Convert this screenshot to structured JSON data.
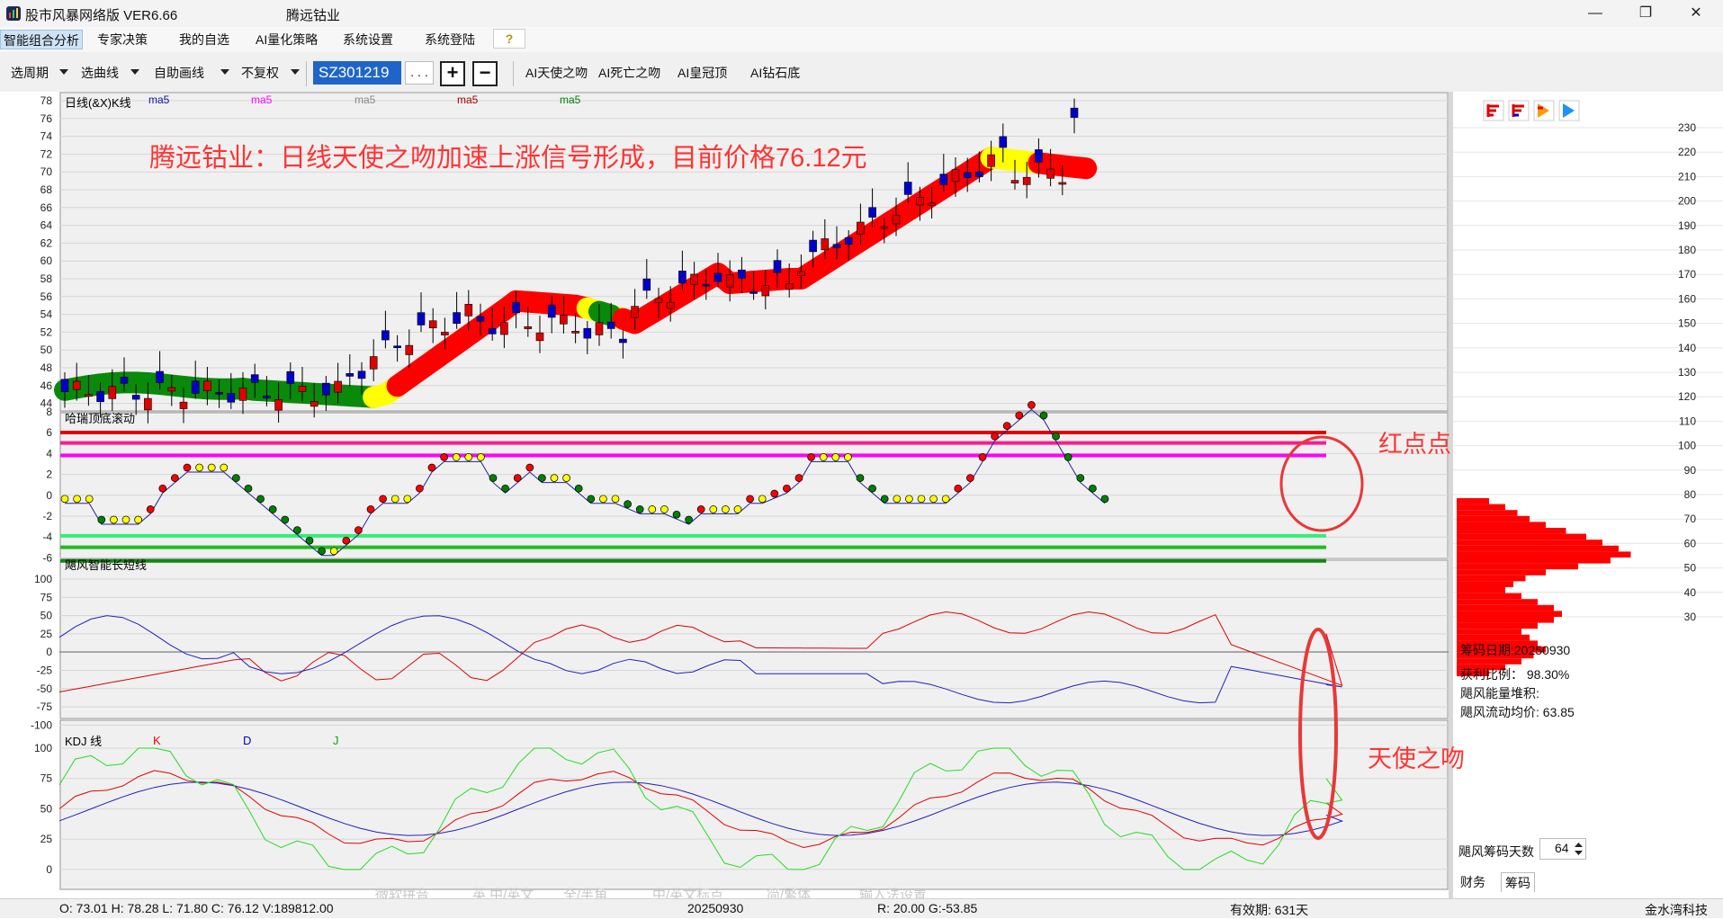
{
  "window": {
    "app_title": "股市风暴网络版 VER6.66",
    "stock_title": "腾远钴业",
    "min_glyph": "—",
    "max_glyph": "❐",
    "close_glyph": "✕"
  },
  "menu": {
    "items": [
      "智能组合分析",
      "专家决策",
      "我的自选",
      "AI量化策略",
      "系统设置",
      "系统登陆"
    ],
    "help": "?"
  },
  "toolbar": {
    "period": "选周期",
    "curve": "选曲线",
    "draw": "自助画线",
    "adjust": "不复权",
    "code": "SZ301219",
    "more": ". . .",
    "zoom_in": "+",
    "zoom_out": "−",
    "ai_buttons": [
      "AI天使之吻",
      "AI死亡之吻",
      "AI皇冠顶",
      "AI钻石底"
    ]
  },
  "colors": {
    "red": "#ff0000",
    "green": "#008000",
    "yellow": "#ffff00",
    "blue": "#0000cc",
    "annotation": "#ff3333"
  },
  "kline_panel": {
    "title": "日线(&X)K线",
    "ma_labels": [
      "ma5",
      "ma5",
      "ma5",
      "ma5",
      "ma5"
    ],
    "ma_colors": [
      "#1010a0",
      "#ff00ff",
      "#888888",
      "#a00000",
      "#008000"
    ],
    "y_ticks": [
      "78",
      "76",
      "74",
      "72",
      "70",
      "68",
      "66",
      "64",
      "62",
      "60",
      "58",
      "56",
      "54",
      "52",
      "50",
      "48",
      "46",
      "44"
    ],
    "annotation": "腾远钴业：日线天使之吻加速上涨信号形成，目前价格76.12元"
  },
  "hr_panel": {
    "title": "哈瑞顶底滚动",
    "y_ticks": [
      "8",
      "6",
      "4",
      "2",
      "0",
      "-2",
      "-4",
      "-6"
    ],
    "annotation": "红点点"
  },
  "ls_panel": {
    "title": "飓风智能长短线",
    "y_ticks": [
      "100",
      "75",
      "50",
      "25",
      "0",
      "-25",
      "-50",
      "-75",
      "-100"
    ]
  },
  "kdj_panel": {
    "title": "KDJ 线",
    "legend": [
      "K",
      "D",
      "J"
    ],
    "y_ticks": [
      "100",
      "75",
      "50",
      "25",
      "0"
    ],
    "annotation": "天使之吻"
  },
  "right_panel": {
    "icon_names": [
      "chip-red-icon",
      "chip-mixed-icon",
      "chip-orange-icon",
      "chip-blue-icon"
    ],
    "price_ticks": [
      "230",
      "220",
      "210",
      "200",
      "190",
      "180",
      "170",
      "160",
      "150",
      "140",
      "130",
      "120",
      "110",
      "100",
      "90",
      "80",
      "70",
      "60",
      "50",
      "40",
      "30"
    ],
    "chip_date": "筹码日期:20250930",
    "profit_ratio": "获利比例：  98.30%",
    "energy": "飓风能量堆积:",
    "avg_cost": "飓风流动均价: 63.85",
    "days_label": "飓风筹码天数",
    "days_value": "64",
    "tabs": [
      "财务",
      "筹码"
    ]
  },
  "status": {
    "ohlc": "O: 73.01  H: 78.28  L: 71.80  C: 76.12  V:189812.00",
    "date": "20250930",
    "rg": "R: 20.00  G:-53.85",
    "valid": "有效期:  631天",
    "company": "金水湾科技"
  },
  "ime_ghost": [
    "微软拼音",
    "英 中/英文",
    "全/半角",
    "中/英文标点",
    "简/繁体",
    "输入法设置"
  ]
}
